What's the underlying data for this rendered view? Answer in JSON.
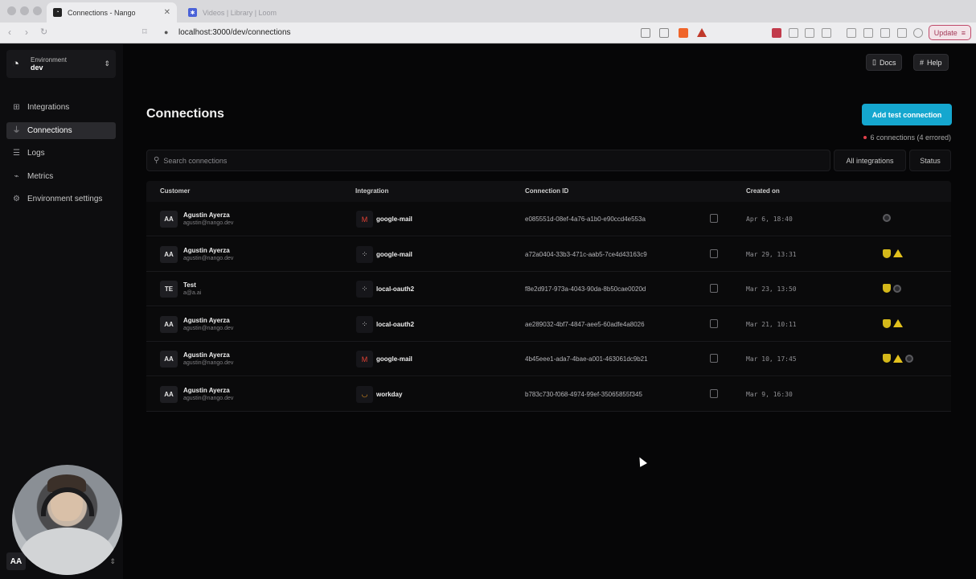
{
  "browser": {
    "tabs": [
      {
        "title": "Connections - Nango",
        "active": true
      },
      {
        "title": "Videos | Library | Loom",
        "active": false
      }
    ],
    "url": "localhost:3000/dev/connections",
    "update_label": "Update"
  },
  "sidebar": {
    "env_label": "Environment",
    "env_value": "dev",
    "items": [
      {
        "label": "Integrations",
        "icon": "grid-icon"
      },
      {
        "label": "Connections",
        "icon": "plug-icon"
      },
      {
        "label": "Logs",
        "icon": "list-icon"
      },
      {
        "label": "Metrics",
        "icon": "chart-icon"
      },
      {
        "label": "Environment settings",
        "icon": "sliders-icon"
      }
    ],
    "user_initials": "AA"
  },
  "header": {
    "docs_label": "Docs",
    "help_label": "Help"
  },
  "main": {
    "title": "Connections",
    "add_button": "Add test connection",
    "count_text": "6 connections (4 errored)",
    "search_placeholder": "Search connections",
    "filter_integrations": "All integrations",
    "filter_status": "Status",
    "columns": [
      "Customer",
      "Integration",
      "Connection ID",
      "Created on"
    ]
  },
  "rows": [
    {
      "initials": "AA",
      "name": "Agustin Ayerza",
      "email": "agustin@nango.dev",
      "integration": "google-mail",
      "integration_icon": "gmail-icon",
      "connection_id": "e085551d-08ef-4a76-a1b0-e90ccd4e553a",
      "created": "Apr 6, 18:40",
      "status": [
        "gray"
      ]
    },
    {
      "initials": "AA",
      "name": "Agustin Ayerza",
      "email": "agustin@nango.dev",
      "integration": "google-mail",
      "integration_icon": "oauth-icon",
      "connection_id": "a72a0404-33b3-471c-aab5-7ce4d43163c9",
      "created": "Mar 29, 13:31",
      "status": [
        "shield",
        "warn"
      ]
    },
    {
      "initials": "TE",
      "name": "Test",
      "email": "a@a.ai",
      "integration": "local-oauth2",
      "integration_icon": "oauth-icon",
      "connection_id": "f8e2d917-973a-4043-90da-8b50cae0020d",
      "created": "Mar 23, 13:50",
      "status": [
        "shield",
        "gray"
      ]
    },
    {
      "initials": "AA",
      "name": "Agustin Ayerza",
      "email": "agustin@nango.dev",
      "integration": "local-oauth2",
      "integration_icon": "oauth-icon",
      "connection_id": "ae289032-4bf7-4847-aee5-60adfe4a8026",
      "created": "Mar 21, 10:11",
      "status": [
        "shield",
        "warn"
      ]
    },
    {
      "initials": "AA",
      "name": "Agustin Ayerza",
      "email": "agustin@nango.dev",
      "integration": "google-mail",
      "integration_icon": "gmail-icon",
      "connection_id": "4b45eee1-ada7-4bae-a001-463061dc9b21",
      "created": "Mar 10, 17:45",
      "status": [
        "shield",
        "warn",
        "gray"
      ]
    },
    {
      "initials": "AA",
      "name": "Agustin Ayerza",
      "email": "agustin@nango.dev",
      "integration": "workday",
      "integration_icon": "workday-icon",
      "connection_id": "b783c730-f068-4974-99ef-35065855f345",
      "created": "Mar 9, 16:30",
      "status": []
    }
  ],
  "colors": {
    "accent": "#15a7cf",
    "warning": "#e3c11d",
    "error": "#e2414b"
  }
}
